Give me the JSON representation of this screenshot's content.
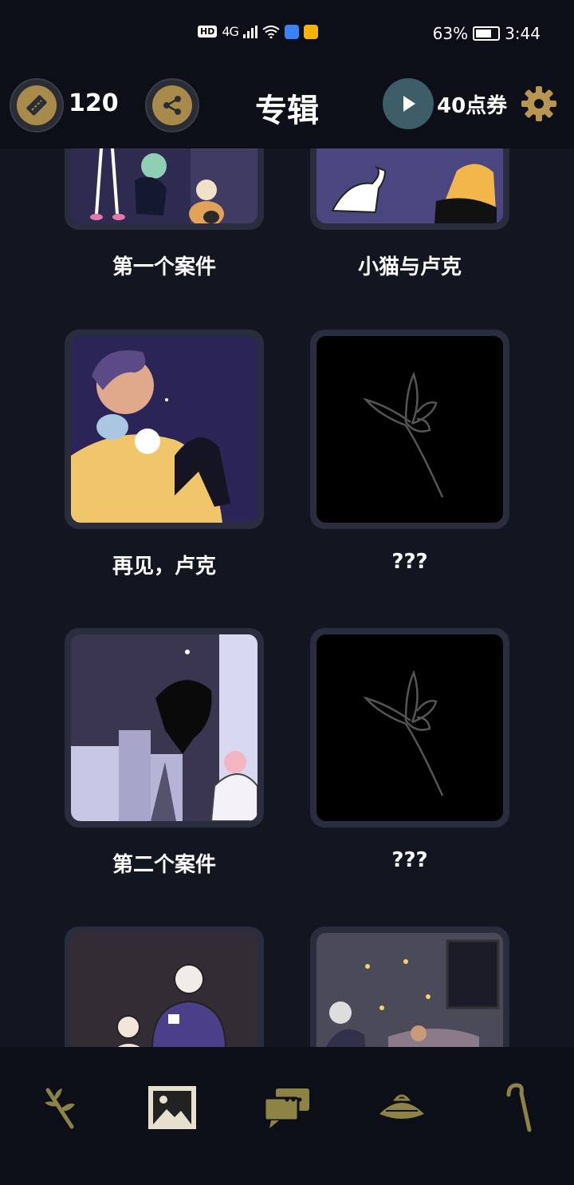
{
  "status_bar": {
    "network": "4G",
    "hd": "HD",
    "battery": "63%",
    "time": "3:44"
  },
  "header": {
    "ticket_count": "120",
    "title": "专辑",
    "voucher": "40点券",
    "icons": [
      "ticket-icon",
      "share-icon",
      "play-icon",
      "gear-icon"
    ]
  },
  "albums": [
    {
      "title": "第一个案件",
      "locked": false
    },
    {
      "title": "小猫与卢克",
      "locked": false
    },
    {
      "title": "再见，卢克",
      "locked": false
    },
    {
      "title": "???",
      "locked": true
    },
    {
      "title": "第二个案件",
      "locked": false
    },
    {
      "title": "???",
      "locked": true
    },
    {
      "title": "",
      "locked": false
    },
    {
      "title": "",
      "locked": false
    }
  ],
  "bottom_nav": {
    "items": [
      "branch-icon",
      "gallery-icon",
      "chat-icon",
      "hat-icon",
      "cane-icon"
    ],
    "active": "gallery-icon"
  },
  "colors": {
    "background": "#121620",
    "bar": "#0c0f17",
    "accent_gold": "#a88a4a",
    "card_frame": "#2a2d3d",
    "play_teal": "#3d5e68"
  }
}
